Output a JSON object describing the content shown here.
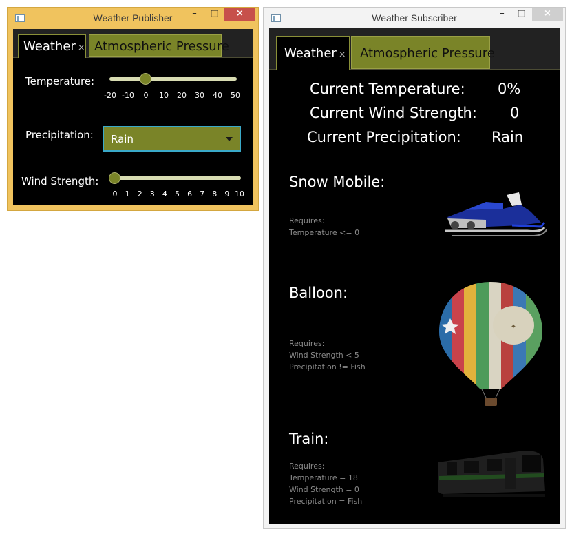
{
  "publisher": {
    "title": "Weather Publisher",
    "window_controls": {
      "minimize": "–",
      "maximize": "□",
      "close": "×"
    },
    "tabs": [
      {
        "label": "Weather",
        "close_glyph": "×",
        "active": true
      },
      {
        "label": "Atmospheric Pressure",
        "active": false
      }
    ],
    "temperature": {
      "label": "Temperature:",
      "ticks": [
        "-20",
        "-10",
        "0",
        "10",
        "20",
        "30",
        "40",
        "50"
      ],
      "min": -20,
      "max": 50,
      "value": 0
    },
    "precipitation": {
      "label": "Precipitation:",
      "selected": "Rain"
    },
    "wind_strength": {
      "label": "Wind Strength:",
      "ticks": [
        "0",
        "1",
        "2",
        "3",
        "4",
        "5",
        "6",
        "7",
        "8",
        "9",
        "10"
      ],
      "min": 0,
      "max": 10,
      "value": 0
    }
  },
  "subscriber": {
    "title": "Weather Subscriber",
    "window_controls": {
      "minimize": "–",
      "maximize": "□",
      "close": "×"
    },
    "tabs": [
      {
        "label": "Weather",
        "close_glyph": "×",
        "active": true
      },
      {
        "label": "Atmospheric Pressure",
        "active": false
      }
    ],
    "current": {
      "temperature": {
        "label": "Current Temperature:",
        "value": "0%"
      },
      "wind": {
        "label": "Current Wind Strength:",
        "value": "0"
      },
      "precipitation": {
        "label": "Current Precipitation:",
        "value": "Rain"
      }
    },
    "items": [
      {
        "title": "Snow Mobile:",
        "requires_label": "Requires:",
        "conditions": [
          "Temperature <= 0"
        ],
        "icon": "snowmobile-image"
      },
      {
        "title": "Balloon:",
        "requires_label": "Requires:",
        "conditions": [
          "Wind Strength < 5",
          "Precipitation != Fish"
        ],
        "icon": "balloon-image"
      },
      {
        "title": "Train:",
        "requires_label": "Requires:",
        "conditions": [
          "Temperature = 18",
          "Wind Strength = 0",
          "Precipitation = Fish"
        ],
        "icon": "train-image"
      }
    ]
  },
  "colors": {
    "accent_olive": "#7a8428",
    "slider_track": "#d8dcb2",
    "focus_border": "#3aa9c9",
    "publisher_frame": "#f0c35e",
    "close_button": "#c7504b"
  }
}
